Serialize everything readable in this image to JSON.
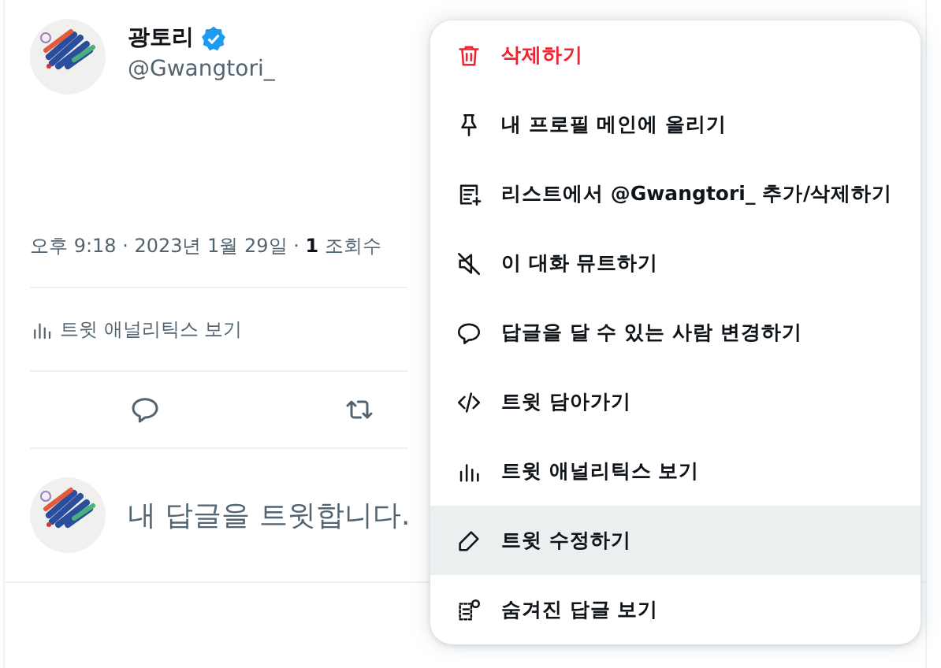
{
  "tweet": {
    "author": {
      "name": "광토리",
      "verified": true,
      "handle": "@Gwangtori_"
    },
    "timestamp": "오후 9:18 · 2023년 1월 29일 · **1** 조회수",
    "analytics_link": "트윗 애널리틱스 보기",
    "actions": [
      {
        "kind": "reply"
      },
      {
        "kind": "retweet"
      }
    ]
  },
  "reply_composer": {
    "placeholder": "내 답글을 트윗합니다."
  },
  "menu": {
    "items": [
      {
        "kind": "delete",
        "label": "삭제하기",
        "danger": true,
        "highlighted": false
      },
      {
        "kind": "pin",
        "label": "내 프로필 메인에 올리기",
        "danger": false,
        "highlighted": false
      },
      {
        "kind": "list",
        "label": "리스트에서 @Gwangtori_ 추가/삭제하기",
        "danger": false,
        "highlighted": false
      },
      {
        "kind": "mute",
        "label": "이 대화 뮤트하기",
        "danger": false,
        "highlighted": false
      },
      {
        "kind": "replies",
        "label": "답글을 달 수 있는 사람 변경하기",
        "danger": false,
        "highlighted": false
      },
      {
        "kind": "embed",
        "label": "트윗 담아가기",
        "danger": false,
        "highlighted": false
      },
      {
        "kind": "analytics",
        "label": "트윗 애널리틱스 보기",
        "danger": false,
        "highlighted": false
      },
      {
        "kind": "edit",
        "label": "트윗 수정하기",
        "danger": false,
        "highlighted": true
      },
      {
        "kind": "hidden",
        "label": "숨겨진 답글 보기",
        "danger": false,
        "highlighted": false
      }
    ]
  }
}
